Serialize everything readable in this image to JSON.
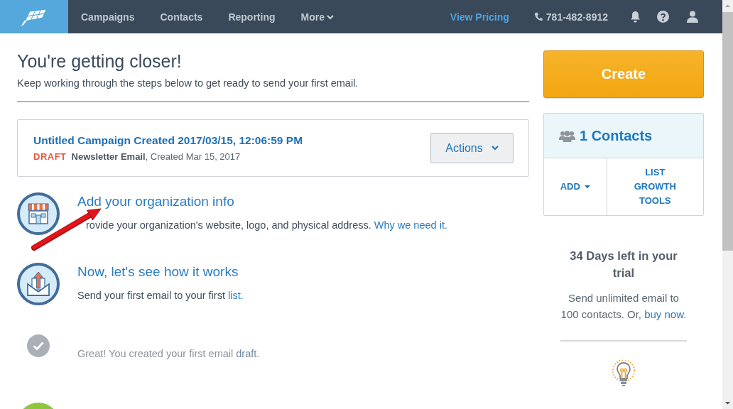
{
  "nav": {
    "items": [
      {
        "label": "Campaigns",
        "dropdown": false
      },
      {
        "label": "Contacts",
        "dropdown": false
      },
      {
        "label": "Reporting",
        "dropdown": false
      },
      {
        "label": "More",
        "dropdown": true
      }
    ],
    "pricing_link": "View Pricing",
    "phone": "781-482-8912"
  },
  "header": {
    "title": "You're getting closer!",
    "subtitle": "Keep working through the steps below to get ready to send your first email."
  },
  "campaign": {
    "title": "Untitled Campaign Created 2017/03/15, 12:06:59 PM",
    "status": "DRAFT",
    "details": "**Newsletter Email**, Created Mar 15, 2017",
    "actions_button": "Actions"
  },
  "steps": [
    {
      "kind": "store",
      "completed": false,
      "title": "Add your organization info",
      "text": "rovide your organization's website, logo, and physical address.",
      "link": "Why we need it."
    },
    {
      "kind": "envelope",
      "completed": false,
      "title": "Now, let's see how it works",
      "text": "Send your first email to your first",
      "link": "list."
    },
    {
      "kind": "check",
      "completed": true,
      "text": "Great! You created your first email",
      "link": "draft."
    },
    {
      "kind": "disc"
    }
  ],
  "annotations": [
    {
      "kind": "arrow"
    }
  ],
  "sidebar": {
    "create_button": "Create",
    "contacts": {
      "title": "1 Contacts",
      "add_button": "ADD",
      "growth_button": "LIST GROWTH TOOLS"
    },
    "trial": {
      "title": "34 Days left in your trial",
      "text": "Send unlimited email to 100 contacts. Or,",
      "link": "buy now."
    }
  }
}
